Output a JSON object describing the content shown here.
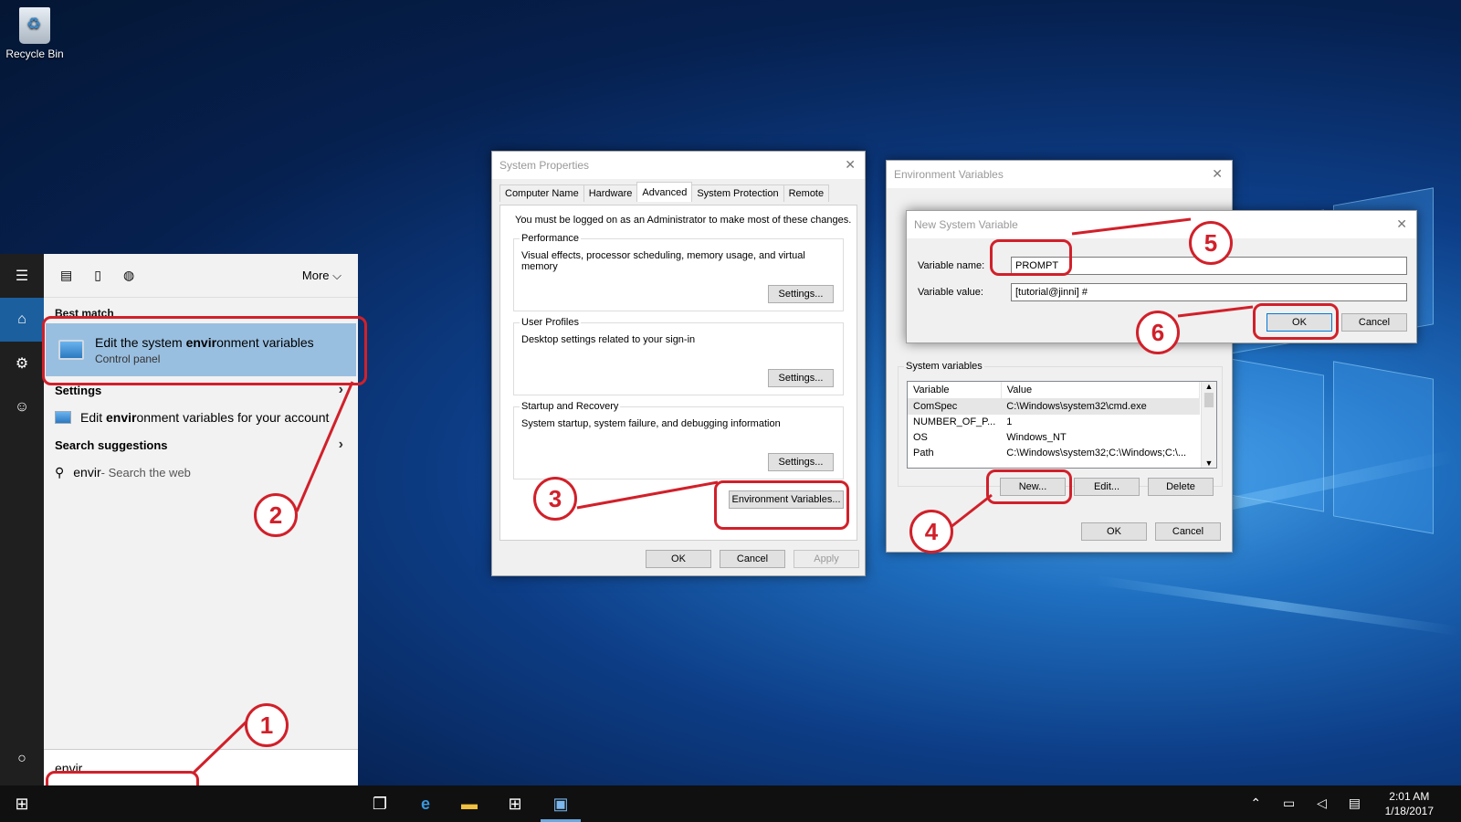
{
  "desktop": {
    "recycle_bin": "Recycle Bin"
  },
  "search_panel": {
    "more_label": "More",
    "best_match_heading": "Best match",
    "best_match": {
      "title_pre": "Edit the system ",
      "title_bold": "envir",
      "title_post": "onment variables",
      "subtitle": "Control panel"
    },
    "settings_heading": "Settings",
    "settings_item": {
      "pre": "Edit ",
      "bold": "envir",
      "post": "onment variables for your account"
    },
    "suggestions_heading": "Search suggestions",
    "suggestion": {
      "term": "envir",
      "suffix": " - Search the web"
    },
    "query": "envir"
  },
  "system_properties": {
    "title": "System Properties",
    "tabs": [
      "Computer Name",
      "Hardware",
      "Advanced",
      "System Protection",
      "Remote"
    ],
    "notice": "You must be logged on as an Administrator to make most of these changes.",
    "performance": {
      "label": "Performance",
      "desc": "Visual effects, processor scheduling, memory usage, and virtual memory",
      "button": "Settings..."
    },
    "user_profiles": {
      "label": "User Profiles",
      "desc": "Desktop settings related to your sign-in",
      "button": "Settings..."
    },
    "startup": {
      "label": "Startup and Recovery",
      "desc": "System startup, system failure, and debugging information",
      "button": "Settings..."
    },
    "env_button": "Environment Variables...",
    "ok": "OK",
    "cancel": "Cancel",
    "apply": "Apply"
  },
  "environment_variables": {
    "title": "Environment Variables",
    "system_vars_label": "System variables",
    "columns": [
      "Variable",
      "Value"
    ],
    "rows": [
      {
        "variable": "ComSpec",
        "value": "C:\\Windows\\system32\\cmd.exe"
      },
      {
        "variable": "NUMBER_OF_P...",
        "value": "1"
      },
      {
        "variable": "OS",
        "value": "Windows_NT"
      },
      {
        "variable": "Path",
        "value": "C:\\Windows\\system32;C:\\Windows;C:\\..."
      }
    ],
    "new": "New...",
    "edit": "Edit...",
    "delete": "Delete",
    "ok": "OK",
    "cancel": "Cancel"
  },
  "new_system_variable": {
    "title": "New System Variable",
    "name_label": "Variable name:",
    "name_value": "PROMPT",
    "value_label": "Variable value:",
    "value_value": "[tutorial@jinni] #",
    "ok": "OK",
    "cancel": "Cancel"
  },
  "annotations": [
    "1",
    "2",
    "3",
    "4",
    "5",
    "6"
  ],
  "taskbar": {
    "time": "2:01 AM",
    "date": "1/18/2017"
  }
}
